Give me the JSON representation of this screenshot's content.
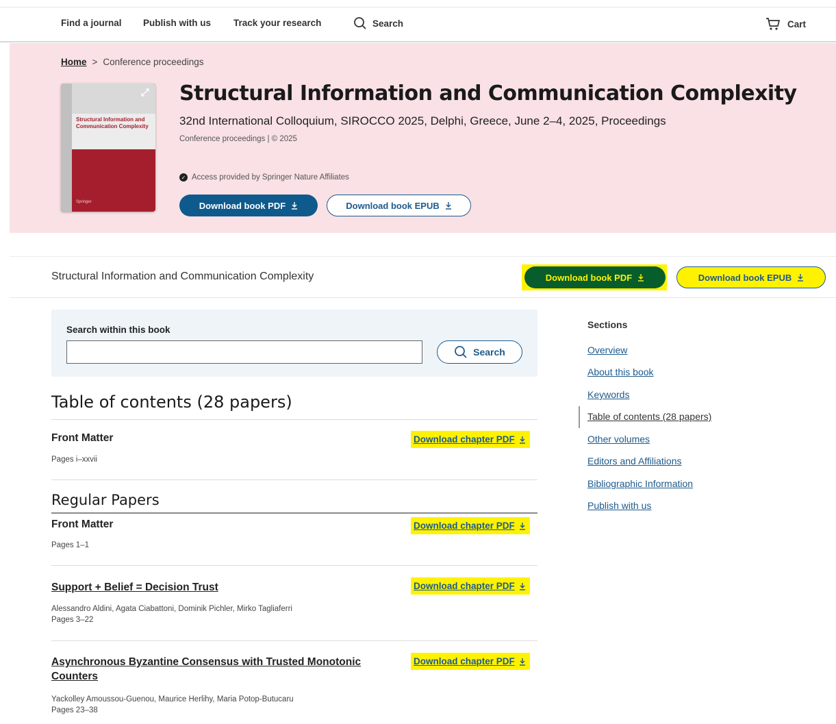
{
  "topnav": {
    "links": [
      "Find a journal",
      "Publish with us",
      "Track your research"
    ],
    "search_label": "Search",
    "cart_label": "Cart"
  },
  "breadcrumb": {
    "home": "Home",
    "separator": ">",
    "current": "Conference proceedings"
  },
  "book": {
    "title": "Structural Information and Communication Complexity",
    "subtitle": "32nd International Colloquium, SIROCCO 2025, Delphi, Greece, June 2–4, 2025, Proceedings",
    "meta": "Conference proceedings | © 2025",
    "access": "Access provided by Springer Nature Affiliates",
    "cover_title": "Structural Information and Communication Complexity",
    "cover_publisher": "Springer"
  },
  "buttons": {
    "download_pdf": "Download book PDF",
    "download_epub": "Download book EPUB"
  },
  "sticky": {
    "title": "Structural Information and Communication Complexity"
  },
  "search_within": {
    "label": "Search within this book",
    "value": "",
    "button": "Search"
  },
  "toc": {
    "heading": "Table of contents (28 papers)",
    "download_label": "Download chapter PDF",
    "front": {
      "title": "Front Matter",
      "pages": "Pages i–xxvii"
    },
    "section_title": "Regular Papers",
    "items": [
      {
        "title": "Front Matter",
        "authors": "",
        "pages": "Pages 1–1"
      },
      {
        "title": "Support + Belief = Decision Trust",
        "authors": "Alessandro Aldini, Agata Ciabattoni, Dominik Pichler, Mirko Tagliaferri",
        "pages": "Pages 3–22"
      },
      {
        "title": "Asynchronous Byzantine Consensus with Trusted Monotonic Counters",
        "authors": "Yackolley Amoussou-Guenou, Maurice Herlihy, Maria Potop-Butucaru",
        "pages": "Pages 23–38"
      }
    ]
  },
  "sidebar": {
    "heading": "Sections",
    "links": [
      "Overview",
      "About this book",
      "Keywords",
      "Table of contents (28 papers)",
      "Other volumes",
      "Editors and Affiliations",
      "Bibliographic Information",
      "Publish with us"
    ]
  },
  "colors": {
    "hero_bg": "#f9e1e5",
    "primary_blue": "#0f5a8c",
    "highlight_yellow": "#fff200",
    "green": "#075e2c",
    "cover_red": "#a51e2e"
  },
  "icons": [
    "search-icon",
    "cart-icon",
    "download-icon",
    "check-icon",
    "expand-icon"
  ]
}
